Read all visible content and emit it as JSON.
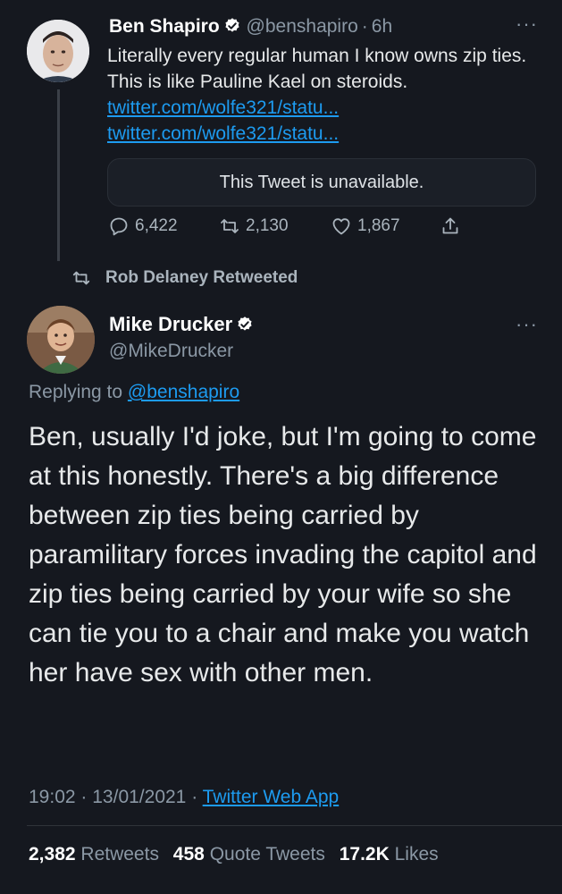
{
  "tweet1": {
    "name": "Ben Shapiro",
    "handle": "@benshapiro",
    "sep": "·",
    "time": "6h",
    "text_plain": "Literally every regular human I know owns zip ties. This is like Pauline Kael on steroids.",
    "link1": "twitter.com/wolfe321/statu...",
    "link2": "twitter.com/wolfe321/statu...",
    "quote_unavailable": "This Tweet is unavailable.",
    "replies": "6,422",
    "retweets": "2,130",
    "likes": "1,867",
    "more": "···"
  },
  "retweeted_by": "Rob Delaney Retweeted",
  "tweet2": {
    "name": "Mike Drucker",
    "handle": "@MikeDrucker",
    "more": "···",
    "replying_prefix": "Replying to",
    "replying_to": "@benshapiro",
    "text": "Ben, usually I'd joke, but I'm going to come at this honestly. There's a big difference between zip ties being carried by paramilitary forces invading the capitol and zip ties being carried by your wife so she can tie you to a chair and make you watch her have sex with other men.",
    "time": "19:02",
    "sep": "·",
    "date": "13/01/2021",
    "source": "Twitter Web App",
    "retweets_count": "2,382",
    "retweets_label": "Retweets",
    "quotes_count": "458",
    "quotes_label": "Quote Tweets",
    "likes_count": "17.2K",
    "likes_label": "Likes"
  },
  "colors": {
    "background": "#15181f",
    "link": "#1d9bf0",
    "verified": "#ffffff",
    "muted": "#8b98a5"
  }
}
